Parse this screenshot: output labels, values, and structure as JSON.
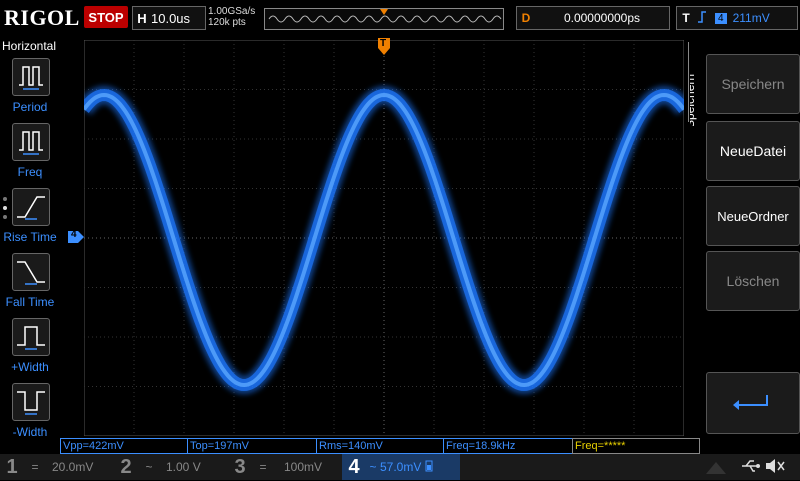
{
  "header": {
    "logo": "RIGOL",
    "run_state": "STOP",
    "timebase_label": "H",
    "timebase_value": "10.0us",
    "sample_rate": "1.00GSa/s",
    "memory_depth": "120k pts",
    "delay_label": "D",
    "delay_value": "0.00000000ps",
    "trigger_label": "T",
    "trigger_channel": "4",
    "trigger_level": "211mV"
  },
  "left_panel": {
    "title": "Horizontal",
    "items": [
      {
        "label": "Period",
        "icon": "period-icon"
      },
      {
        "label": "Freq",
        "icon": "frequency-icon"
      },
      {
        "label": "Rise Time",
        "icon": "rise-time-icon"
      },
      {
        "label": "Fall Time",
        "icon": "fall-time-icon"
      },
      {
        "label": "+Width",
        "icon": "positive-width-icon"
      },
      {
        "label": "-Width",
        "icon": "negative-width-icon"
      }
    ]
  },
  "right_panel": {
    "tab_label": "Speichern",
    "buttons": [
      {
        "label": "Speichern",
        "enabled": false
      },
      {
        "label": "NeueDatei",
        "enabled": true
      },
      {
        "label": "NeueOrdner",
        "enabled": true
      },
      {
        "label": "Löschen",
        "enabled": false
      }
    ],
    "enter_icon": "enter-icon"
  },
  "markers": {
    "trigger_pos": "T",
    "channel_ref": "4"
  },
  "measurements": [
    {
      "text": "Vpp=422mV"
    },
    {
      "text": "Top=197mV"
    },
    {
      "text": "Rms=140mV"
    },
    {
      "text": "Freq=18.9kHz"
    },
    {
      "text": "Freq=*****"
    }
  ],
  "channels": [
    {
      "num": "1",
      "coupling": "=",
      "scale": "20.0mV"
    },
    {
      "num": "2",
      "coupling": "~",
      "scale": "1.00 V"
    },
    {
      "num": "3",
      "coupling": "=",
      "scale": "100mV"
    },
    {
      "num": "4",
      "coupling": "~",
      "scale": "57.0mV"
    }
  ],
  "colors": {
    "trace": "#1e78ff",
    "accent_blue": "#3c8fff",
    "stop_red": "#bb0000",
    "trigger_orange": "#f08000"
  }
}
